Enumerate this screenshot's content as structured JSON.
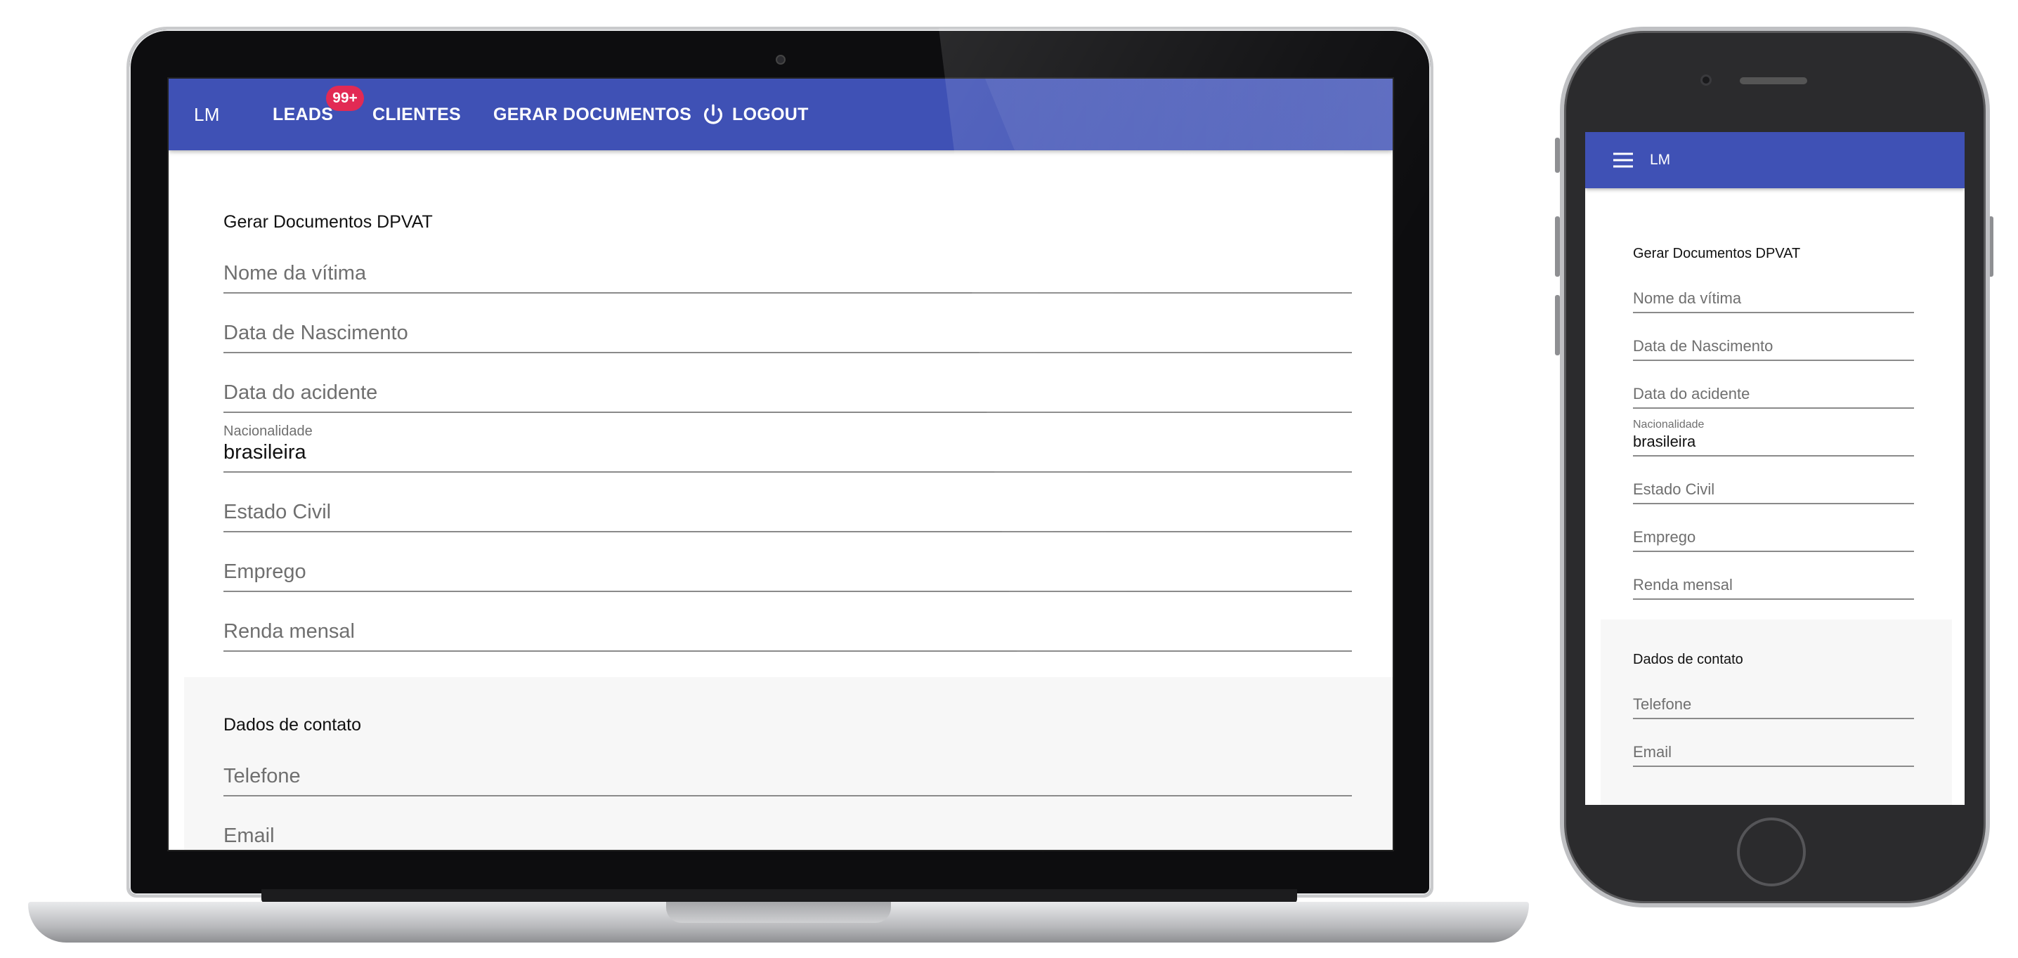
{
  "laptop": {
    "nav": {
      "brand": "LM",
      "leads": "LEADS",
      "leads_badge": "99+",
      "clientes": "CLIENTES",
      "gerar_documentos": "GERAR DOCUMENTOS",
      "logout": "LOGOUT"
    },
    "form": {
      "section_title": "Gerar Documentos DPVAT",
      "fields": [
        {
          "placeholder": "Nome da vítima"
        },
        {
          "placeholder": "Data de Nascimento"
        },
        {
          "placeholder": "Data do acidente"
        },
        {
          "label": "Nacionalidade",
          "value": "brasileira"
        },
        {
          "placeholder": "Estado Civil"
        },
        {
          "placeholder": "Emprego"
        },
        {
          "placeholder": "Renda mensal"
        }
      ],
      "contact_title": "Dados de contato",
      "contact_fields": [
        {
          "placeholder": "Telefone"
        },
        {
          "placeholder": "Email"
        }
      ]
    }
  },
  "phone": {
    "nav": {
      "brand": "LM",
      "menu_icon": "hamburger-menu-icon"
    },
    "form": {
      "section_title": "Gerar Documentos DPVAT",
      "fields": [
        {
          "placeholder": "Nome da vítima"
        },
        {
          "placeholder": "Data de Nascimento"
        },
        {
          "placeholder": "Data do acidente"
        },
        {
          "label": "Nacionalidade",
          "value": "brasileira"
        },
        {
          "placeholder": "Estado Civil"
        },
        {
          "placeholder": "Emprego"
        },
        {
          "placeholder": "Renda mensal"
        }
      ],
      "contact_title": "Dados de contato",
      "contact_fields": [
        {
          "placeholder": "Telefone"
        },
        {
          "placeholder": "Email"
        }
      ]
    }
  },
  "colors": {
    "primary": "#3f51b5",
    "badge": "#e22a54",
    "field_line": "#8a8a8a",
    "placeholder_text": "#6f6f6f",
    "contact_bg": "#f7f7f7"
  }
}
